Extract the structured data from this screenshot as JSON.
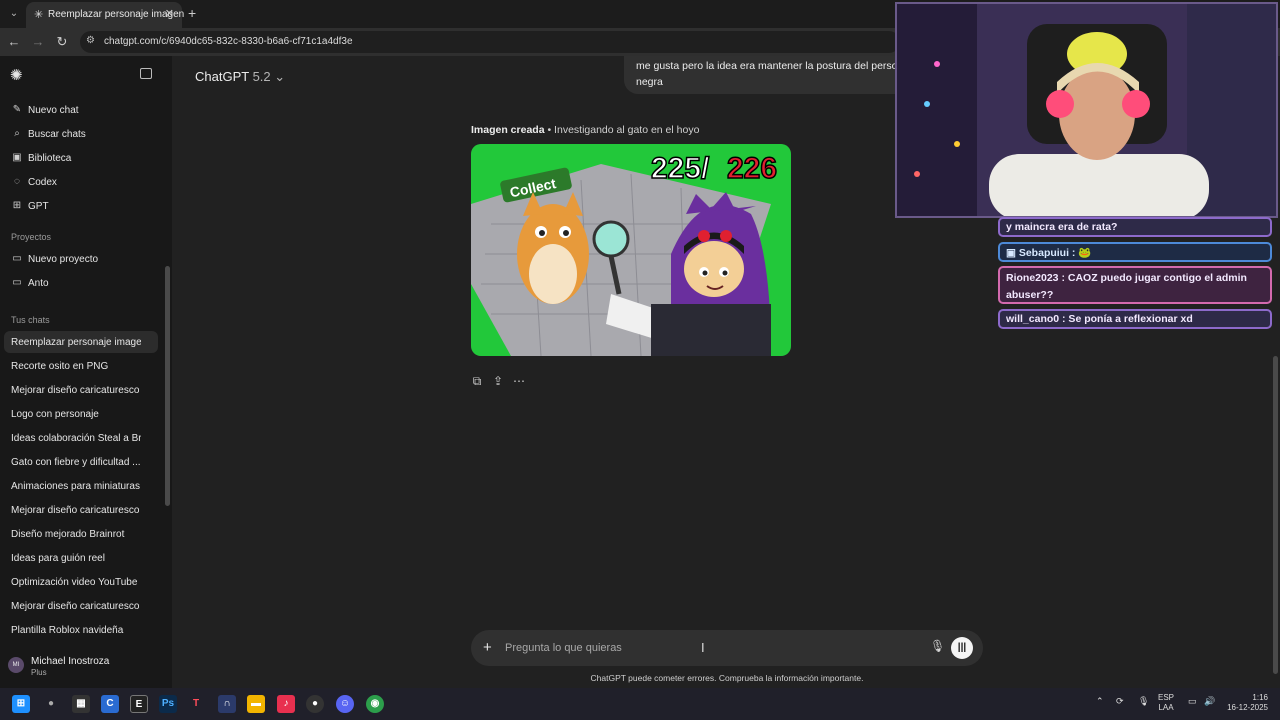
{
  "browser": {
    "tab_title": "Reemplazar personaje imagen",
    "url": "chatgpt.com/c/6940dc65-832c-8330-b6a6-cf71c1a4df3e"
  },
  "sidebar": {
    "top_items": [
      {
        "label": "Nuevo chat",
        "icon": "edit-icon"
      },
      {
        "label": "Buscar chats",
        "icon": "search-icon"
      },
      {
        "label": "Biblioteca",
        "icon": "images-icon"
      },
      {
        "label": "Codex",
        "icon": "codex-icon"
      },
      {
        "label": "GPT",
        "icon": "grid-icon"
      }
    ],
    "projects_heading": "Proyectos",
    "projects": [
      {
        "label": "Nuevo proyecto",
        "icon": "folder-plus-icon"
      },
      {
        "label": "Anto",
        "icon": "folder-icon"
      }
    ],
    "chats_heading": "Tus chats",
    "chats": [
      "Reemplazar personaje imagen",
      "Recorte osito en PNG",
      "Mejorar diseño caricaturesco",
      "Logo con personaje",
      "Ideas colaboración Steal a Br...",
      "Gato con fiebre y dificultad ...",
      "Animaciones para miniaturas",
      "Mejorar diseño caricaturesco",
      "Diseño mejorado Brainrot",
      "Ideas para guión reel",
      "Optimización video YouTube",
      "Mejorar diseño caricaturesco",
      "Plantilla Roblox navideña"
    ],
    "user": {
      "name": "Michael Inostroza",
      "plan": "Plus",
      "initials": "MI"
    }
  },
  "main": {
    "model_name": "ChatGPT",
    "model_version": "5.2",
    "user_message": "me gusta pero la idea era mantener la postura del perso negra",
    "image_caption_bold": "Imagen creada",
    "image_caption_rest": " • Investigando al gato en el hoyo",
    "image_text": {
      "collect": "Collect",
      "counter_a": "225/",
      "counter_b": "226"
    },
    "composer_placeholder": "Pregunta lo que quieras",
    "disclaimer": "ChatGPT puede cometer errores. Comprueba la información importante."
  },
  "stream_chat": [
    {
      "text": "y maincra era de rata?"
    },
    {
      "text": "Sebapuiui :"
    },
    {
      "text": "Rione2023 : CAOZ puedo jugar contigo el admin abuser??"
    },
    {
      "text": "will_cano0 : Se ponía a reflexionar xd"
    }
  ],
  "taskbar": {
    "lang_top": "ESP",
    "lang_bottom": "LAA",
    "time": "1:16",
    "date": "16-12-2025"
  },
  "colors": {
    "image_green": "#22c83a",
    "counter_red": "#e02030",
    "stream_purple": "#8d6acb"
  }
}
